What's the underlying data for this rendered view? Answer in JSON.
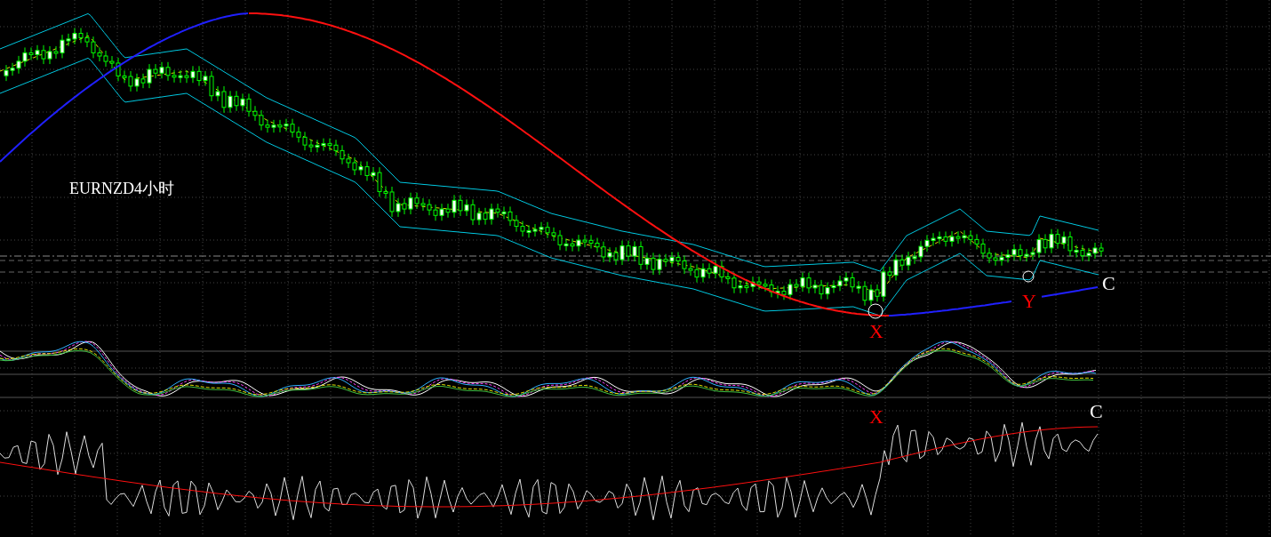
{
  "chart": {
    "title": "EURNZD4小时",
    "markers": [
      {
        "text": "C",
        "color": "#ffffff"
      },
      {
        "text": "Y",
        "color": "#ff0000"
      },
      {
        "text": "X",
        "color": "#ff0000"
      },
      {
        "text": "X",
        "color": "#ff0000"
      },
      {
        "text": "C",
        "color": "#ffffff"
      }
    ]
  }
}
